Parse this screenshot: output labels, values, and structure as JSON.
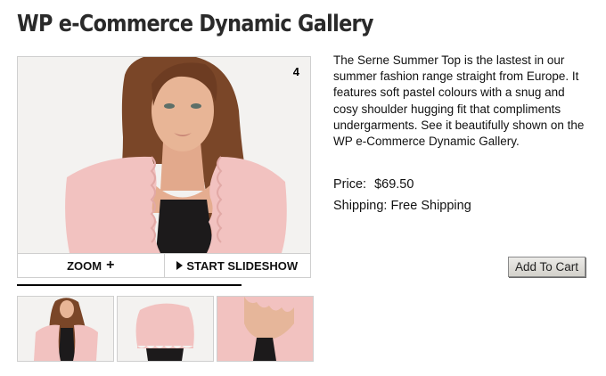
{
  "page": {
    "title": "WP e-Commerce Dynamic Gallery"
  },
  "gallery": {
    "counter": "4",
    "zoom_label": "ZOOM",
    "zoom_icon": "+",
    "slideshow_label": "START SLIDESHOW",
    "slideshow_icon": "play-icon",
    "thumbnails": [
      "thumbnail-1",
      "thumbnail-2",
      "thumbnail-3"
    ]
  },
  "product": {
    "description": "The Serne Summer Top is the lastest in our summer fashion range straight from Europe. It features soft pastel colours with a snug and cosy shoulder hugging fit that compliments undergarments. See it beautifully shown on the WP e-Commerce Dynamic Gallery.",
    "price_label": "Price:",
    "price_value": "$69.50",
    "shipping_label": "Shipping:",
    "shipping_value": "Free Shipping",
    "add_to_cart_label": "Add To Cart"
  },
  "colors": {
    "cardigan_pink": "#f2c2c0",
    "top_black": "#1c1a1b",
    "hair_brown": "#7a4628",
    "skin": "#e8b596",
    "background": "#f3f2f0"
  }
}
